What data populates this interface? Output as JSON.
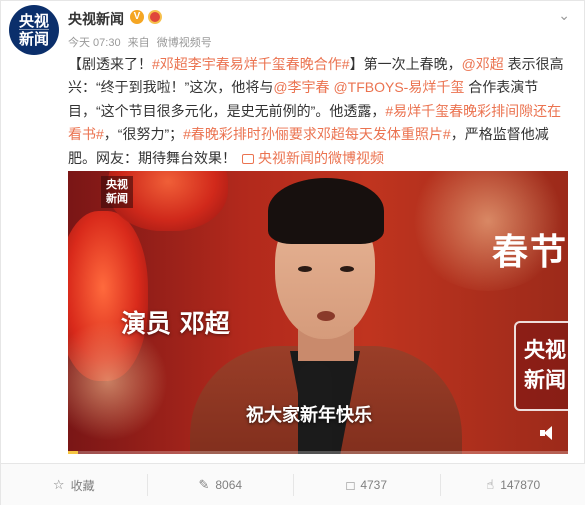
{
  "author": {
    "avatar_line1": "央视",
    "avatar_line2": "新闻",
    "name": "央视新闻",
    "verified_icon": "verified-badge-icon",
    "medal_icon": "medal-icon"
  },
  "meta": {
    "time": "今天 07:30",
    "source_prefix": "来自",
    "source": "微博视频号"
  },
  "post": {
    "p1": "【剧透来了！",
    "p2": "#邓超李宇春易烊千玺春晚合作#",
    "p3": "】第一次上春晚，",
    "p4": "@邓超",
    "p5": " 表示很高兴：“终于到我啦！”这次，他将与",
    "p6": "@李宇春",
    "p7": " ",
    "p8": "@TFBOYS-易烊千玺",
    "p9": " 合作表演节目，“这个节目很多元化，是史无前例的”。他透露，",
    "p10": "#易烊千玺春晚彩排间隙还在看书#",
    "p11": "，“很努力”；",
    "p12": "#春晚彩排时孙俪要求邓超每天发体重照片#",
    "p13": "，严格监督他减肥。网友：期待舞台效果！",
    "video_link": "央视新闻的微博视频"
  },
  "video": {
    "watermark_line1": "央视",
    "watermark_line2": "新闻",
    "caption_role": "演员 邓超",
    "caption_line": "祝大家新年快乐",
    "backdrop_text": "春节",
    "corner_brand_1": "央视",
    "corner_brand_2": "新闻",
    "progress": 0.02
  },
  "actions": {
    "favorite": "收藏",
    "repost": "8064",
    "comment": "4737",
    "like": "147870"
  }
}
